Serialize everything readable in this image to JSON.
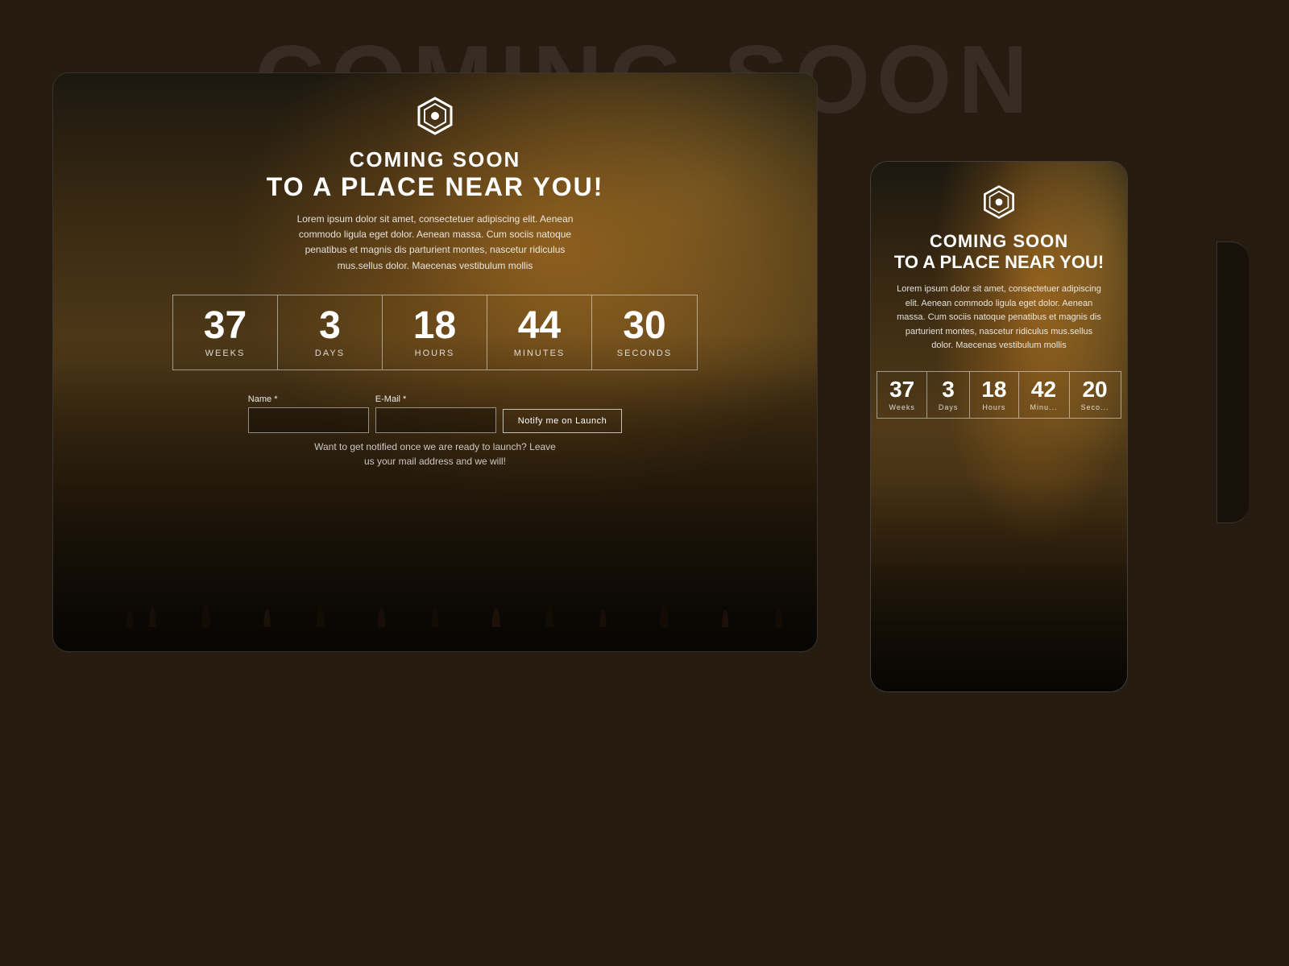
{
  "background": {
    "title": "COMING SOON"
  },
  "desktop": {
    "logo": "hexagon-logo",
    "heading_line1": "COMING SOON",
    "heading_line2": "TO A PLACE NEAR YOU!",
    "description": "Lorem ipsum dolor sit amet, consectetuer adipiscing elit. Aenean commodo ligula eget dolor. Aenean massa. Cum sociis natoque penatibus et magnis dis parturient montes, nascetur ridiculus mus.sellus dolor. Maecenas vestibulum mollis",
    "countdown": [
      {
        "value": "37",
        "label": "WEEKS"
      },
      {
        "value": "3",
        "label": "DAYS"
      },
      {
        "value": "18",
        "label": "HOURS"
      },
      {
        "value": "44",
        "label": "MINUTES"
      },
      {
        "value": "30",
        "label": "SECONDS"
      }
    ],
    "form": {
      "name_label": "Name *",
      "email_label": "E-Mail *",
      "name_placeholder": "",
      "email_placeholder": "",
      "button_label": "Notify me on Launch",
      "hint": "Want to get notified once we are ready to launch? Leave us your mail address and we will!"
    }
  },
  "mobile": {
    "logo": "hexagon-logo-mobile",
    "heading_line1": "COMING SOON",
    "heading_line2": "TO A PLACE NEAR YOU!",
    "description": "Lorem ipsum dolor sit amet, consectetuer adipiscing elit. Aenean commodo ligula eget dolor. Aenean massa. Cum sociis natoque penatibus et magnis dis parturient montes, nascetur ridiculus mus.sellus dolor. Maecenas vestibulum mollis",
    "countdown": [
      {
        "value": "37",
        "label": "Weeks"
      },
      {
        "value": "3",
        "label": "Days"
      },
      {
        "value": "18",
        "label": "Hours"
      },
      {
        "value": "42",
        "label": "Minu..."
      },
      {
        "value": "20",
        "label": "Seco..."
      }
    ]
  }
}
